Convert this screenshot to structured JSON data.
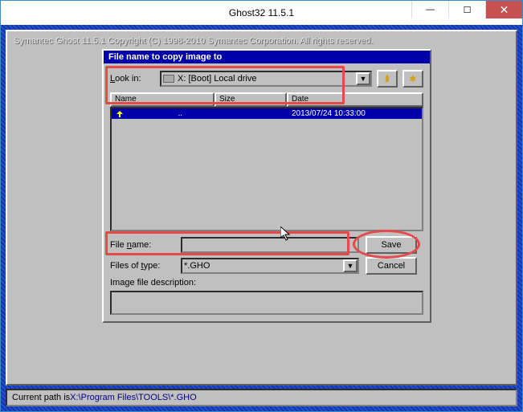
{
  "titlebar": {
    "title": "Ghost32 11.5.1"
  },
  "copyright": "Symantec Ghost 11.5.1    Copyright (C) 1998-2010 Symantec Corporation. All rights reserved.",
  "dialog": {
    "title": "File name to copy image to",
    "lookin_label": {
      "pre": "",
      "u": "L",
      "post": "ook in:"
    },
    "lookin_value": "X: [Boot] Local drive",
    "columns": {
      "name": "Name",
      "size": "Size",
      "date": "Date"
    },
    "items": [
      {
        "name": "..",
        "size": "",
        "date": "2013/07/24 10:33:00",
        "selected": true
      }
    ],
    "filename_label": {
      "pre": "File ",
      "u": "n",
      "post": "ame:"
    },
    "filename_value": "",
    "filetype_label": {
      "pre": "Files of ",
      "u": "t",
      "post": "ype:"
    },
    "filetype_value": "*.GHO",
    "desc_label": "Image file description:",
    "save": {
      "pre": "",
      "u": "S",
      "post": "ave"
    },
    "cancel": {
      "pre": "",
      "u": "C",
      "post": "ancel"
    }
  },
  "status": {
    "prefix": "Current path is ",
    "path": "X:\\Program Files\\TOOLS\\*.GHO"
  }
}
